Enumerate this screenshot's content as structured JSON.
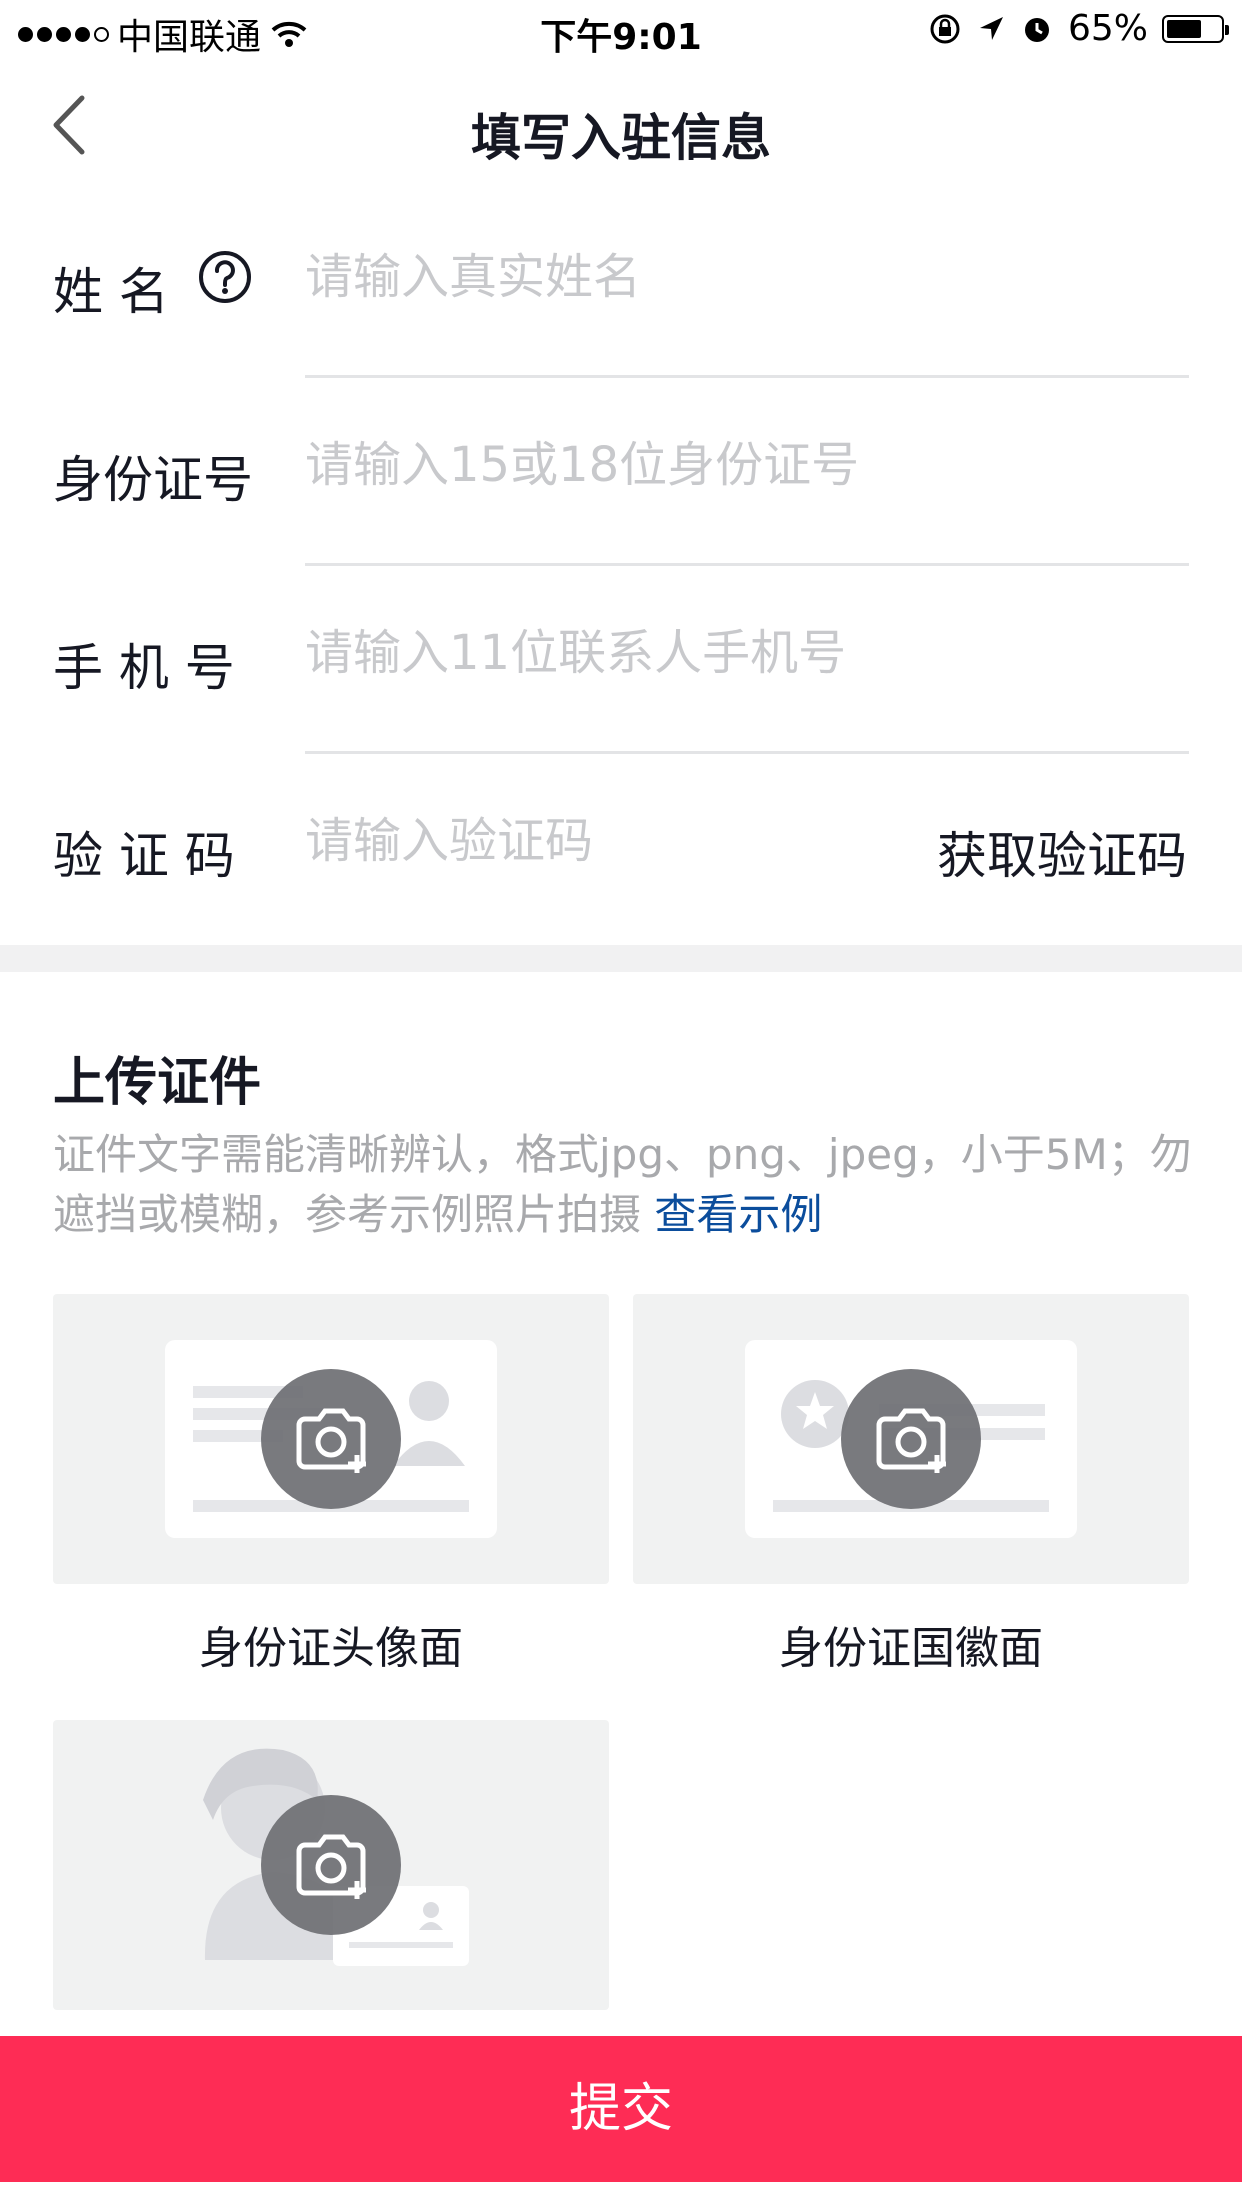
{
  "status_bar": {
    "carrier": "中国联通",
    "time": "下午9:01",
    "battery": "65%",
    "battery_level": 0.65
  },
  "nav": {
    "title": "填写入驻信息",
    "back_icon": "chevron-left-icon"
  },
  "form": {
    "name": {
      "label": "姓 名",
      "placeholder": "请输入真实姓名",
      "help_icon": "question-circle-icon"
    },
    "id_number": {
      "label": "身份证号",
      "placeholder": "请输入15或18位身份证号"
    },
    "phone": {
      "label": "手 机 号",
      "placeholder": "请输入11位联系人手机号"
    },
    "code": {
      "label": "验 证 码",
      "placeholder": "请输入验证码",
      "get_code": "获取验证码"
    }
  },
  "upload": {
    "title": "上传证件",
    "description": "证件文字需能清晰辨认，格式jpg、png、jpeg，小于5M；勿遮挡或模糊，参考示例照片拍摄 ",
    "example_link": "查看示例",
    "cards": [
      {
        "caption": "身份证头像面",
        "icon": "camera-plus-icon"
      },
      {
        "caption": "身份证国徽面",
        "icon": "camera-plus-icon"
      },
      {
        "caption": "",
        "icon": "camera-plus-icon"
      }
    ]
  },
  "submit": {
    "label": "提交"
  },
  "colors": {
    "accent": "#fe2c55",
    "link": "#0b4d9c",
    "placeholder": "#c8c9cc",
    "card_bg": "#f1f2f2"
  }
}
